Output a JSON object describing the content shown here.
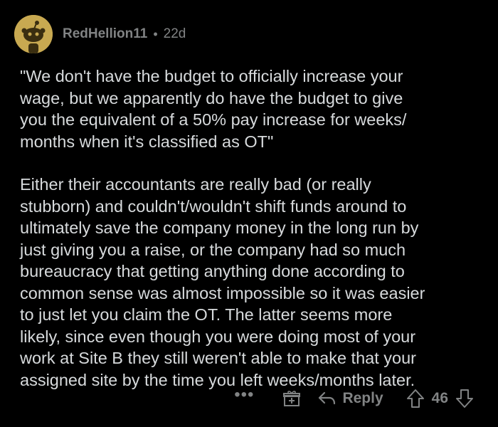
{
  "comment": {
    "author": "RedHellion11",
    "separator": "•",
    "age": "22d",
    "avatar_icon": "snoo-avatar-icon",
    "paragraphs": [
      "\"We don't have the budget to officially increase your\nwage, but we apparently do have the budget to give\nyou the equivalent of a 50% pay increase for weeks/\nmonths when it's classified as OT\"",
      "Either their accountants are really bad (or really\nstubborn) and couldn't/wouldn't shift funds around to\nultimately save the company money in the long run by\njust giving you a raise, or the company had so much\nbureaucracy that getting anything done according to\ncommon sense was almost impossible so it was easier\nto just let you claim the OT. The latter seems more\nlikely, since even though you were doing most of your\nwork at Site B they still weren't able to make that your\nassigned site by the time you left weeks/months later."
    ]
  },
  "actions": {
    "more_label": "•••",
    "award_icon": "gift-icon",
    "reply_icon": "reply-arrow-icon",
    "reply_label": "Reply",
    "upvote_icon": "upvote-arrow-icon",
    "score": "46",
    "downvote_icon": "downvote-arrow-icon"
  },
  "colors": {
    "background": "#000000",
    "text_primary": "#d7dadc",
    "text_muted": "#818384",
    "avatar_bg": "#c8a951"
  }
}
